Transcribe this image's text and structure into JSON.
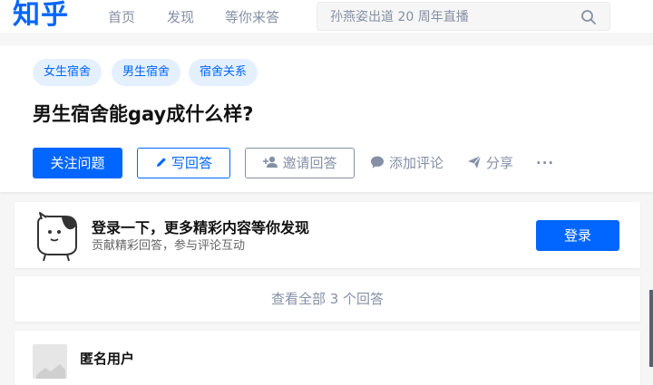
{
  "header": {
    "logo": "知乎",
    "nav": [
      "首页",
      "发现",
      "等你来答"
    ],
    "search_placeholder": "孙燕姿出道 20 周年直播"
  },
  "question": {
    "tags": [
      "女生宿舍",
      "男生宿舍",
      "宿舍关系"
    ],
    "title": "男生宿舍能gay成什么样?",
    "follow_label": "关注问题",
    "write_label": "写回答",
    "invite_label": "邀请回答",
    "comment_label": "添加评论",
    "share_label": "分享",
    "more_label": "···"
  },
  "login_prompt": {
    "title": "登录一下，更多精彩内容等你发现",
    "subtitle": "贡献精彩回答，参与评论互动",
    "button": "登录"
  },
  "answers": {
    "view_all": "查看全部 3 个回答"
  },
  "first_answer": {
    "author": "匿名用户"
  },
  "colors": {
    "brand": "#0066ff",
    "tag_bg": "#e5f0ff",
    "muted": "#8590a6",
    "page_bg": "#f6f6f6"
  },
  "icons": [
    "search-icon",
    "pencil-icon",
    "add-user-icon",
    "comment-icon",
    "paper-plane-icon",
    "more-icon",
    "mascot-icon"
  ]
}
